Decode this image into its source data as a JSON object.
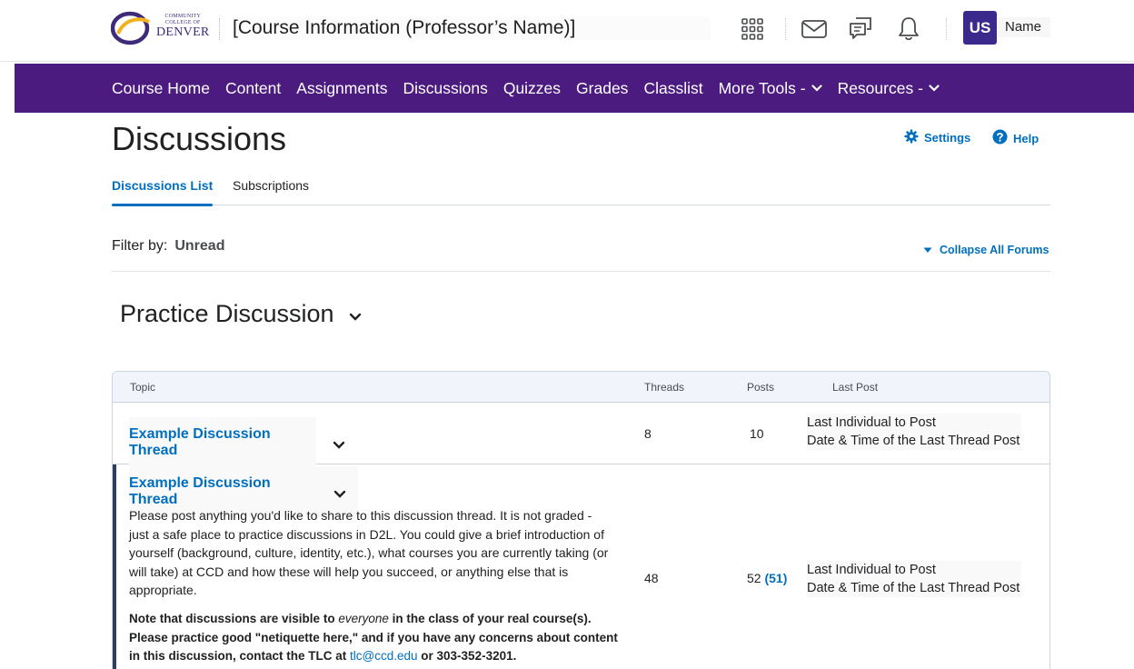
{
  "header": {
    "logo": {
      "line1": "COMMUNITY",
      "line2": "COLLEGE OF",
      "line3": "DENVER"
    },
    "course_title": "[Course Information (Professor’s Name)]",
    "user_initials": "US",
    "user_name": "Name",
    "icons": [
      "waffle-icon",
      "mail-icon",
      "chat-icon",
      "bell-icon"
    ]
  },
  "nav": {
    "items": [
      {
        "label": "Course Home",
        "dropdown": false
      },
      {
        "label": "Content",
        "dropdown": false
      },
      {
        "label": "Assignments",
        "dropdown": false
      },
      {
        "label": "Discussions",
        "dropdown": false
      },
      {
        "label": "Quizzes",
        "dropdown": false
      },
      {
        "label": "Grades",
        "dropdown": false
      },
      {
        "label": "Classlist",
        "dropdown": false
      },
      {
        "label": "More Tools -",
        "dropdown": true
      },
      {
        "label": "Resources -",
        "dropdown": true
      }
    ]
  },
  "page": {
    "title": "Discussions",
    "settings_label": "Settings",
    "help_label": "Help",
    "tabs": [
      {
        "label": "Discussions List",
        "active": true
      },
      {
        "label": "Subscriptions",
        "active": false
      }
    ],
    "filter_label": "Filter by:",
    "filter_value": "Unread",
    "collapse_label": "Collapse All Forums",
    "forum_title": "Practice Discussion"
  },
  "table": {
    "headers": {
      "topic": "Topic",
      "threads": "Threads",
      "posts": "Posts",
      "last_post": "Last Post"
    },
    "rows": [
      {
        "topic": "Example Discussion Thread",
        "threads": "8",
        "posts": "10",
        "last_post_name": "Last Individual to Post",
        "last_post_date": "Date & Time of the Last Thread Post"
      },
      {
        "topic": "Example Discussion Thread",
        "description": "Please post anything you'd like to share to this discussion thread. It is not graded - just a safe place to practice discussions in D2L.  You could give a brief introduction of yourself (background, culture, identity, etc.), what courses you are currently taking (or will take) at CCD and how these will help you succeed, or anything else that is appropriate.",
        "note_pre": "Note that discussions are visible to ",
        "note_em": "everyone",
        "note_mid": " in the class of your real course(s). Please practice good \"netiquette here,\" and if you have any concerns about content in this discussion, contact the TLC at ",
        "note_email": "tlc@ccd.edu",
        "note_post": " or 303-352-3201.",
        "threads": "48",
        "posts": "52",
        "unread": "(51)",
        "last_post_name": "Last Individual to Post",
        "last_post_date": "Date & Time of the Last Thread Post"
      }
    ]
  },
  "colors": {
    "nav_bg": "#4b1b7f",
    "link": "#006fbf",
    "avatar_bg": "#3b2a8c"
  }
}
